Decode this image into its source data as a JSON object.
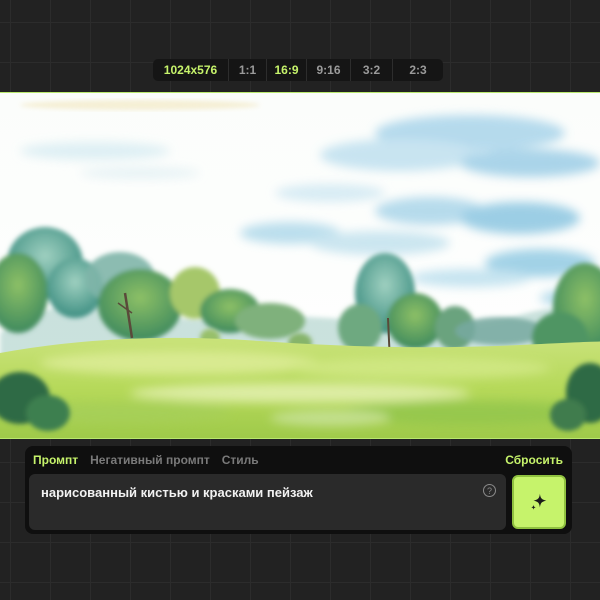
{
  "aspect_ratio_bar": {
    "options": [
      {
        "label": "1024x576",
        "active": true
      },
      {
        "label": "1:1",
        "active": false
      },
      {
        "label": "16:9",
        "active": true
      },
      {
        "label": "9:16",
        "active": false
      },
      {
        "label": "3:2",
        "active": false
      },
      {
        "label": "2:3",
        "active": false
      }
    ]
  },
  "canvas": {
    "image": "generated watercolor landscape",
    "border_color": "#b9e86d"
  },
  "prompt_panel": {
    "tabs": [
      {
        "label": "Промпт",
        "active": true
      },
      {
        "label": "Негативный промпт",
        "active": false
      },
      {
        "label": "Стиль",
        "active": false
      }
    ],
    "reset_label": "Сбросить",
    "prompt_value": "нарисованный кистью и красками пейзаж",
    "help_icon": "question-circle-icon",
    "help_glyph": "?",
    "generate_icon": "sparkle-icon"
  },
  "colors": {
    "accent": "#c6f36b",
    "background": "#222222",
    "panel": "#0f0f0f",
    "input": "#2a2a2a"
  }
}
